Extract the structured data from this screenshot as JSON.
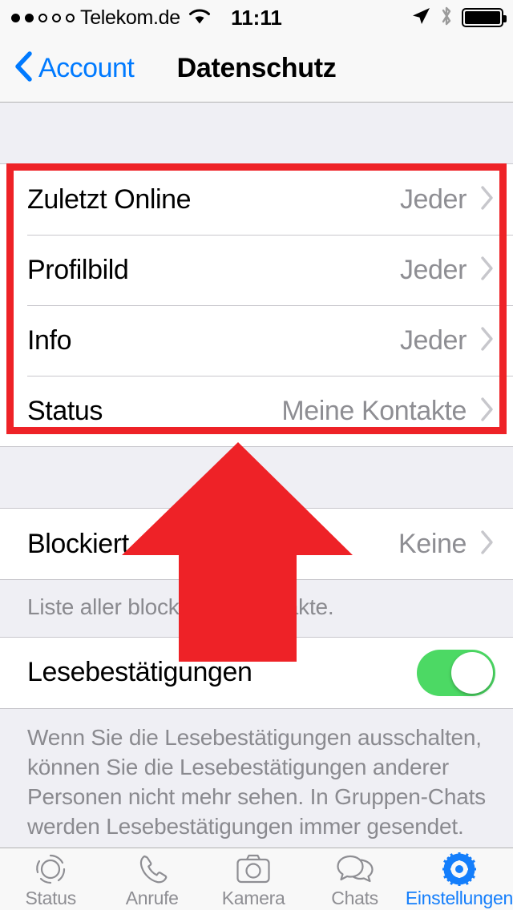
{
  "status_bar": {
    "carrier": "Telekom.de",
    "signal_bars_filled": 2,
    "signal_bars_total": 5,
    "wifi_icon": "wifi-icon",
    "time": "11:11",
    "location_icon": "location-arrow-icon",
    "bluetooth_icon": "bluetooth-icon",
    "battery_icon": "battery-full-icon",
    "battery_level": 100
  },
  "nav_bar": {
    "back_label": "Account",
    "back_icon": "chevron-left-icon",
    "title": "Datenschutz"
  },
  "sections": {
    "privacy": {
      "rows": [
        {
          "label": "Zuletzt Online",
          "value": "Jeder"
        },
        {
          "label": "Profilbild",
          "value": "Jeder"
        },
        {
          "label": "Info",
          "value": "Jeder"
        },
        {
          "label": "Status",
          "value": "Meine Kontakte"
        }
      ]
    },
    "blocked": {
      "row": {
        "label": "Blockiert",
        "value": "Keine"
      },
      "footer": "Liste aller blockierten Kontakte."
    },
    "read_receipts": {
      "row": {
        "label": "Lesebestätigungen",
        "toggle_on": true
      },
      "footer": "Wenn Sie die Lesebestätigungen ausschalten, können Sie die Lesebestätigungen anderer Personen nicht mehr sehen. In Gruppen-Chats werden Lesebestätigungen immer gesendet."
    }
  },
  "annotations": {
    "highlight_color": "#EE2227",
    "arrow_color": "#EE2227",
    "highlight_target": "privacy-section",
    "arrow_target": "privacy-section"
  },
  "tab_bar": {
    "tabs": [
      {
        "label": "Status",
        "icon": "status-ring-icon",
        "active": false
      },
      {
        "label": "Anrufe",
        "icon": "phone-icon",
        "active": false
      },
      {
        "label": "Kamera",
        "icon": "camera-icon",
        "active": false
      },
      {
        "label": "Chats",
        "icon": "chats-bubbles-icon",
        "active": false
      },
      {
        "label": "Einstellungen",
        "icon": "gear-icon",
        "active": true
      }
    ],
    "accent_color": "#147EFB",
    "inactive_color": "#8E8E93"
  },
  "colors": {
    "tint_blue": "#007AFF",
    "toggle_green": "#4CD964",
    "value_gray": "#8E8E93",
    "group_background": "#EFEFF4"
  }
}
